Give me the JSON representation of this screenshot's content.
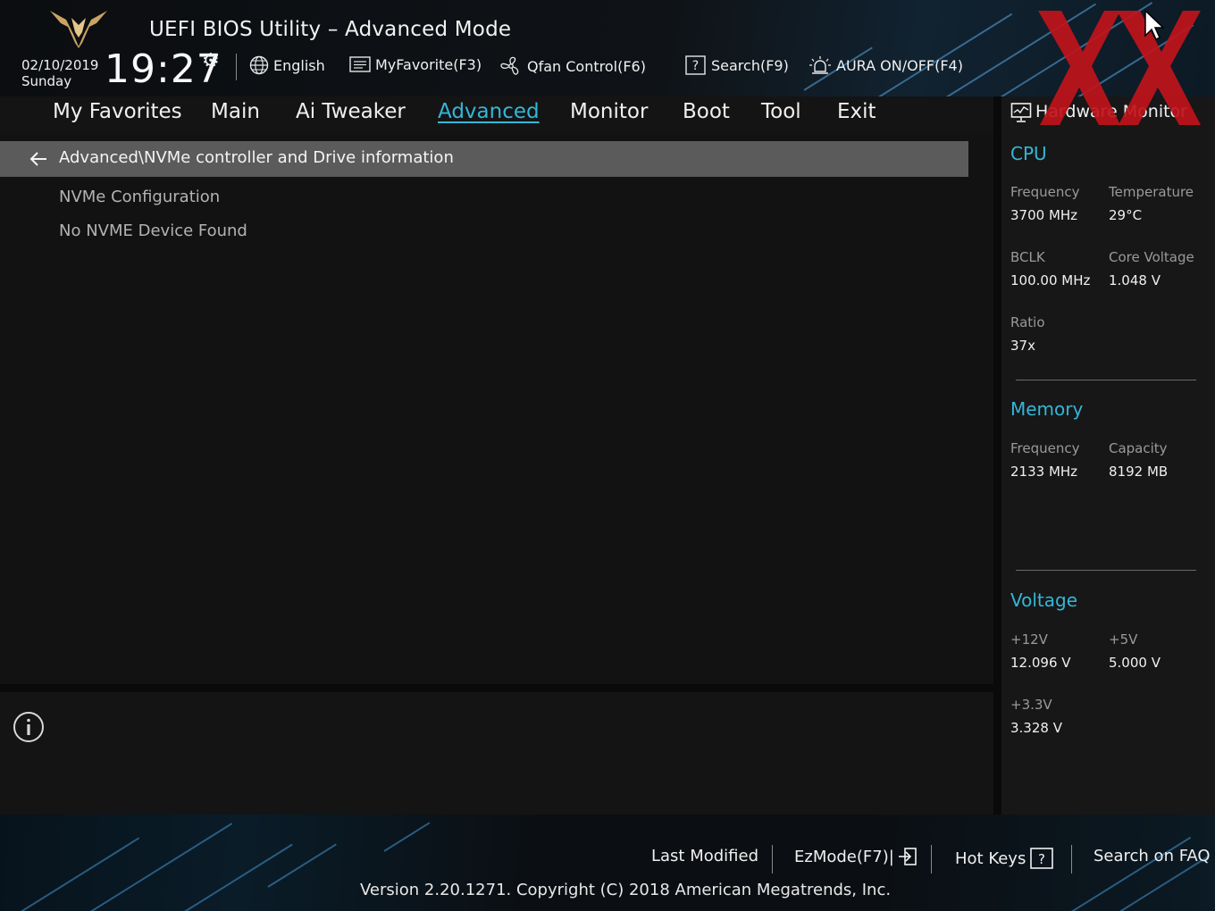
{
  "header": {
    "title": "UEFI BIOS Utility – Advanced Mode",
    "date": "02/10/2019",
    "day": "Sunday",
    "time": "19:27",
    "toolbar": {
      "language": "English",
      "myfavorite": "MyFavorite(F3)",
      "qfan": "Qfan Control(F6)",
      "search": "Search(F9)",
      "aura": "AURA ON/OFF(F4)"
    }
  },
  "tabs": [
    "My Favorites",
    "Main",
    "Ai Tweaker",
    "Advanced",
    "Monitor",
    "Boot",
    "Tool",
    "Exit"
  ],
  "active_tab": "Advanced",
  "main": {
    "breadcrumb": "Advanced\\NVMe controller and Drive information",
    "items": [
      "NVMe Configuration",
      "No NVME Device Found"
    ]
  },
  "hardware_monitor": {
    "title": "Hardware Monitor",
    "cpu": {
      "heading": "CPU",
      "frequency_label": "Frequency",
      "frequency": "3700 MHz",
      "temperature_label": "Temperature",
      "temperature": "29°C",
      "bclk_label": "BCLK",
      "bclk": "100.00 MHz",
      "core_voltage_label": "Core Voltage",
      "core_voltage": "1.048 V",
      "ratio_label": "Ratio",
      "ratio": "37x"
    },
    "memory": {
      "heading": "Memory",
      "frequency_label": "Frequency",
      "frequency": "2133 MHz",
      "capacity_label": "Capacity",
      "capacity": "8192 MB"
    },
    "voltage": {
      "heading": "Voltage",
      "v12_label": "+12V",
      "v12": "12.096 V",
      "v5_label": "+5V",
      "v5": "5.000 V",
      "v33_label": "+3.3V",
      "v33": "3.328 V"
    }
  },
  "footer": {
    "last_modified": "Last Modified",
    "ezmode": "EzMode(F7)|",
    "hot_keys": "Hot Keys",
    "search_faq": "Search on FAQ",
    "version": "Version 2.20.1271. Copyright (C) 2018 American Megatrends, Inc."
  },
  "colors": {
    "accent": "#35b6d8",
    "watermark": "#c0141b",
    "breadcrumb_bg": "#5b5b5b"
  },
  "icons": [
    "tuf-logo-icon",
    "gear-icon",
    "globe-icon",
    "favorite-list-icon",
    "fan-icon",
    "help-search-icon",
    "aura-light-icon",
    "back-arrow-icon",
    "info-icon",
    "monitor-icon",
    "exit-ezmode-icon",
    "hot-keys-icon",
    "mouse-cursor-icon"
  ]
}
